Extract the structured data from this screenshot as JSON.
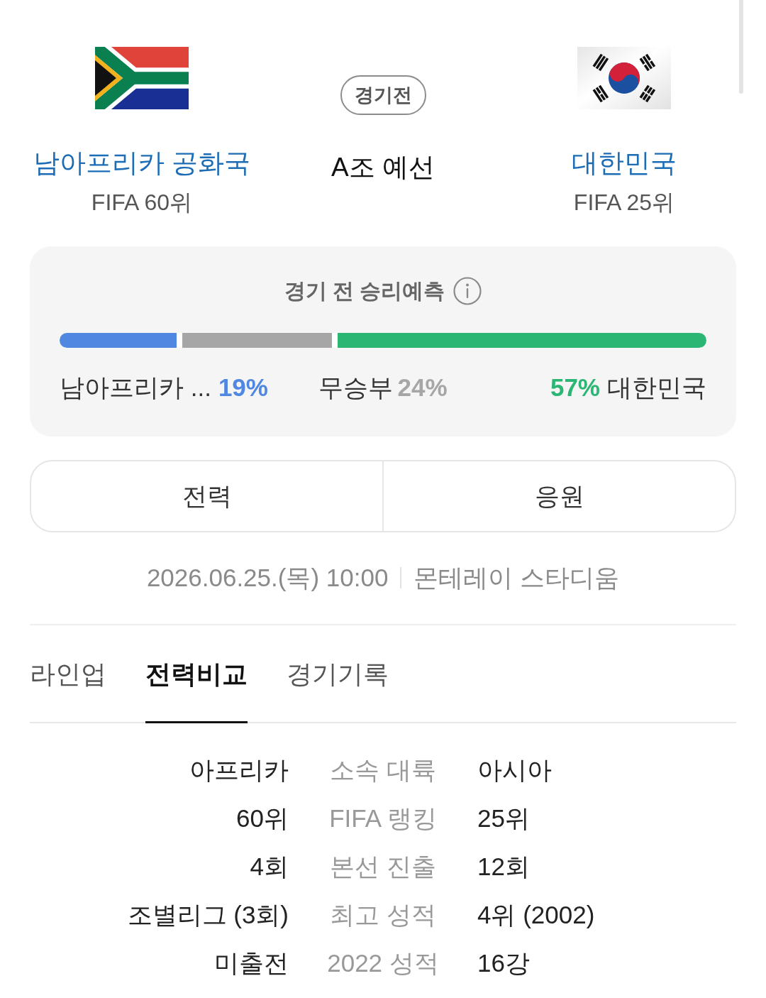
{
  "teams": [
    {
      "name": "남아프리카 공화국",
      "rank": "FIFA 60위"
    },
    {
      "name": "대한민국",
      "rank": "FIFA 25위"
    }
  ],
  "match": {
    "status": "경기전",
    "stage": "A조 예선"
  },
  "prediction": {
    "title": "경기 전 승리예측",
    "outcomes": [
      {
        "kind": "home",
        "label": "남아프리카 ...",
        "percent": "19%",
        "level": 0.19,
        "color": "#4f87e1"
      },
      {
        "kind": "draw",
        "label": "무승부",
        "percent": "24%",
        "level": 0.24,
        "color": "#a6a6a6"
      },
      {
        "kind": "away",
        "label": "대한민국",
        "percent": "57%",
        "level": 0.57,
        "color": "#2cb673"
      }
    ]
  },
  "buttons": [
    {
      "label": "전력"
    },
    {
      "label": "응원"
    }
  ],
  "match_info": {
    "datetime": "2026.06.25.(목) 10:00",
    "venue": "몬테레이 스타디움"
  },
  "tabs": [
    {
      "label": "라인업",
      "selected": false
    },
    {
      "label": "전력비교",
      "selected": true
    },
    {
      "label": "경기기록",
      "selected": false
    }
  ],
  "comparison": {
    "rows": [
      {
        "home": "아프리카",
        "label": "소속 대륙",
        "away": "아시아"
      },
      {
        "home": "60위",
        "label": "FIFA 랭킹",
        "away": "25위"
      },
      {
        "home": "4회",
        "label": "본선 진출",
        "away": "12회"
      },
      {
        "home": "조별리그 (3회)",
        "label": "최고 성적",
        "away": "4위 (2002)"
      },
      {
        "home": "미출전",
        "label": "2022 성적",
        "away": "16강"
      }
    ]
  }
}
